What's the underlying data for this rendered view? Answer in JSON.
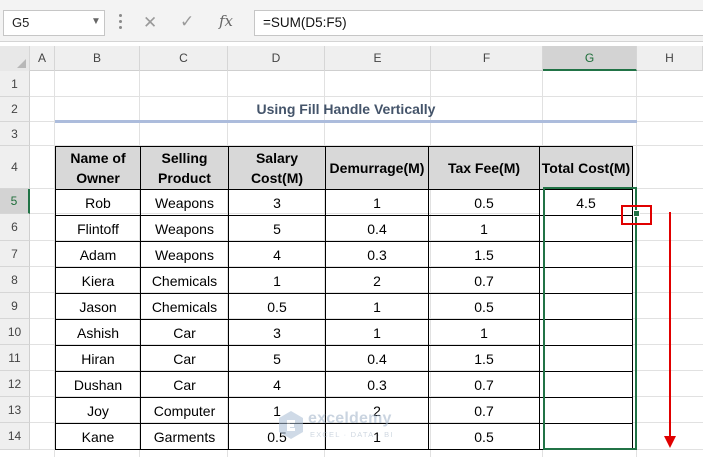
{
  "formula_bar": {
    "name_box": "G5",
    "cancel_icon": "✕",
    "enter_icon": "✓",
    "fx_label": "fx",
    "formula": "=SUM(D5:F5)"
  },
  "columns": [
    "A",
    "B",
    "C",
    "D",
    "E",
    "F",
    "G",
    "H"
  ],
  "rows": [
    "1",
    "2",
    "3",
    "4",
    "5",
    "6",
    "7",
    "8",
    "9",
    "10",
    "11",
    "12",
    "13",
    "14"
  ],
  "selected_column": "G",
  "selected_row": "5",
  "title": "Using Fill Handle Vertically",
  "table": {
    "headers": [
      "Name of Owner",
      "Selling Product",
      "Salary Cost(M)",
      "Demurrage(M)",
      "Tax Fee(M)",
      "Total Cost(M)"
    ],
    "rows": [
      [
        "Rob",
        "Weapons",
        "3",
        "1",
        "0.5",
        "4.5"
      ],
      [
        "Flintoff",
        "Weapons",
        "5",
        "0.4",
        "1",
        ""
      ],
      [
        "Adam",
        "Weapons",
        "4",
        "0.3",
        "1.5",
        ""
      ],
      [
        "Kiera",
        "Chemicals",
        "1",
        "2",
        "0.7",
        ""
      ],
      [
        "Jason",
        "Chemicals",
        "0.5",
        "1",
        "0.5",
        ""
      ],
      [
        "Ashish",
        "Car",
        "3",
        "1",
        "1",
        ""
      ],
      [
        "Hiran",
        "Car",
        "5",
        "0.4",
        "1.5",
        ""
      ],
      [
        "Dushan",
        "Car",
        "4",
        "0.3",
        "0.7",
        ""
      ],
      [
        "Joy",
        "Computer",
        "1",
        "2",
        "0.7",
        ""
      ],
      [
        "Kane",
        "Garments",
        "0.5",
        "1",
        "0.5",
        ""
      ]
    ]
  },
  "watermark": {
    "name": "exceldemy",
    "tagline": "EXCEL · DATA · BI"
  },
  "colors": {
    "selection": "#217346",
    "annotation": "#e00000",
    "title": "#44546a",
    "header_fill": "#d8d8d8"
  }
}
